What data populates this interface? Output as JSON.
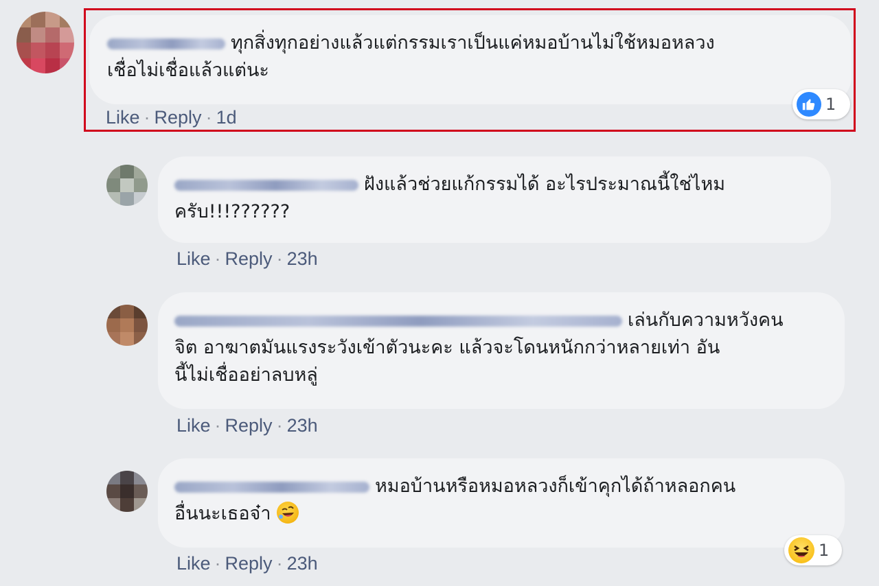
{
  "comments": [
    {
      "text_line1": "ทุกสิ่งทุกอย่างแล้วแต่กรรมเราเป็นแค่หมอบ้านไม่ใช้หมอหลวง",
      "text_line2": "เชื่อไม่เชื่อแล้วแต่นะ",
      "like_label": "Like",
      "reply_label": "Reply",
      "time": "1d",
      "reaction": {
        "icon": "thumbs-up-icon",
        "count": "1",
        "color": "#2e89ff"
      }
    },
    {
      "text_line1": "ฝังแล้วช่วยแก้กรรมได้ อะไรประมาณนี้ใช่ไหม",
      "text_line2": "ครับ!!!??????",
      "like_label": "Like",
      "reply_label": "Reply",
      "time": "23h"
    },
    {
      "text_line1": "เล่นกับความหวังคน",
      "text_line2": "จิต อาฆาตมันแรงระวังเข้าตัวนะคะ แล้วจะโดนหนักกว่าหลายเท่า อัน",
      "text_line3": "นี้ไม่เชื่ออย่าลบหลู่",
      "like_label": "Like",
      "reply_label": "Reply",
      "time": "23h"
    },
    {
      "text_line1": "หมอบ้านหรือหมอหลวงก็เข้าคุกได้ถ้าหลอกคน",
      "text_line2": "อื่นนะเธอจ๋า",
      "like_label": "Like",
      "reply_label": "Reply",
      "time": "23h",
      "reaction": {
        "icon": "haha-icon",
        "count": "1",
        "color": "#f7b500"
      }
    }
  ],
  "separator": "·",
  "highlight_color": "#d0021b"
}
